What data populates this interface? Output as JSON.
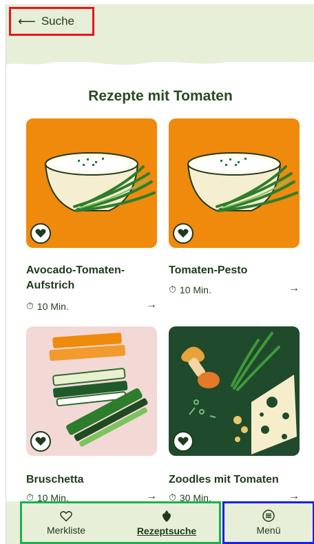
{
  "header": {
    "back_label": "Suche",
    "back_icon": "arrow-left-icon"
  },
  "page": {
    "title": "Rezepte mit Tomaten"
  },
  "recipes": [
    {
      "title": "Avocado-Tomaten-Aufstrich",
      "time": "10 Min.",
      "image": "bowl-with-chives",
      "bg": "#ef8a0c"
    },
    {
      "title": "Tomaten-Pesto",
      "time": "10 Min.",
      "image": "bowl-with-chives",
      "bg": "#ef8a0c"
    },
    {
      "title": "Bruschetta",
      "time": "10 Min.",
      "image": "vegetable-sticks",
      "bg": "#f3d9d6"
    },
    {
      "title": "Zoodles mit Tomaten",
      "time": "30 Min.",
      "image": "mushroom-cheese-herbs",
      "bg": "#1f4a2c"
    }
  ],
  "nav": {
    "merkliste": "Merkliste",
    "rezeptsuche": "Rezeptsuche",
    "menu": "Menü"
  },
  "colors": {
    "accent_green": "#1f3a1c",
    "mint_bg": "#e7efd9",
    "orange": "#ef8a0c"
  }
}
